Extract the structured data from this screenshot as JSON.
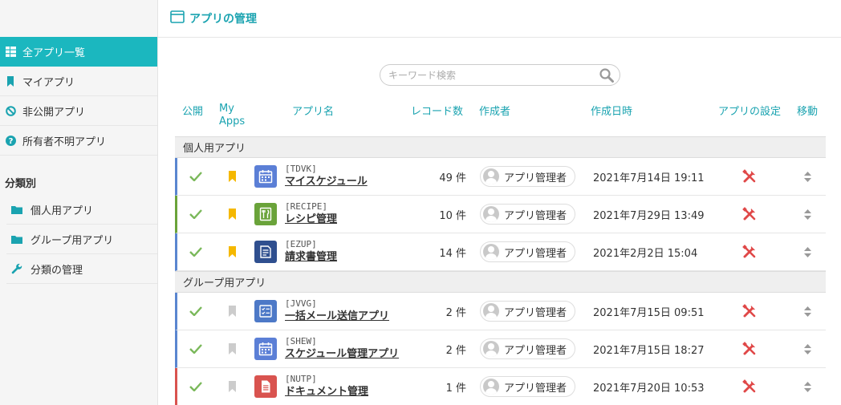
{
  "header": {
    "title": "アプリの管理",
    "icon": "window-icon"
  },
  "sidebar": {
    "items": [
      {
        "label": "全アプリ一覧",
        "icon": "grid-icon",
        "active": true
      },
      {
        "label": "マイアプリ",
        "icon": "bookmark-icon"
      },
      {
        "label": "非公開アプリ",
        "icon": "forbidden-icon"
      },
      {
        "label": "所有者不明アプリ",
        "icon": "question-icon"
      }
    ],
    "category_heading": "分類別",
    "categories": [
      {
        "label": "個人用アプリ",
        "icon": "folder-icon"
      },
      {
        "label": "グループ用アプリ",
        "icon": "folder-icon"
      },
      {
        "label": "分類の管理",
        "icon": "wrench-icon"
      }
    ]
  },
  "search": {
    "placeholder": "キーワード検索",
    "value": ""
  },
  "columns": {
    "public": "公開",
    "myapps_1": "My",
    "myapps_2": "Apps",
    "app_name": "アプリ名",
    "records": "レコード数",
    "creator": "作成者",
    "created": "作成日時",
    "settings": "アプリの設定",
    "move": "移動"
  },
  "groups": [
    {
      "label": "個人用アプリ",
      "apps": [
        {
          "code": "[TDVK]",
          "name": "マイスケジュール",
          "records": "49 件",
          "creator": "アプリ管理者",
          "created": "2021年7月14日 19:11",
          "starred": true,
          "icon": "calendar-icon",
          "icon_color": "#5b7fd6",
          "accent": "#5a86d0"
        },
        {
          "code": "[RECIPE]",
          "name": "レシピ管理",
          "records": "10 件",
          "creator": "アプリ管理者",
          "created": "2021年7月29日 13:49",
          "starred": true,
          "icon": "fork-knife-icon",
          "icon_color": "#6aa33a",
          "accent": "#6aa33a"
        },
        {
          "code": "[EZUP]",
          "name": "請求書管理",
          "records": "14 件",
          "creator": "アプリ管理者",
          "created": "2021年2月2日 15:04",
          "starred": true,
          "icon": "invoice-icon",
          "icon_color": "#2f4f8f",
          "accent": "#5a86d0"
        }
      ]
    },
    {
      "label": "グループ用アプリ",
      "apps": [
        {
          "code": "[JVVG]",
          "name": "一括メール送信アプリ",
          "records": "2 件",
          "creator": "アプリ管理者",
          "created": "2021年7月15日 09:51",
          "starred": false,
          "icon": "checklist-icon",
          "icon_color": "#4d79c7",
          "accent": "#5a86d0"
        },
        {
          "code": "[SHEW]",
          "name": "スケジュール管理アプリ",
          "records": "2 件",
          "creator": "アプリ管理者",
          "created": "2021年7月15日 18:27",
          "starred": false,
          "icon": "calendar-icon",
          "icon_color": "#5b7fd6",
          "accent": "#5a86d0"
        },
        {
          "code": "[NUTP]",
          "name": "ドキュメント管理",
          "records": "1 件",
          "creator": "アプリ管理者",
          "created": "2021年7月20日 10:53",
          "starred": false,
          "icon": "document-icon",
          "icon_color": "#d9534f",
          "accent": "#d9534f"
        }
      ]
    }
  ],
  "colors": {
    "accent": "#1bb7bf",
    "link": "#1aa3b0",
    "check": "#7ab85a",
    "star_on": "#f5b800",
    "star_off": "#cccccc",
    "settings": "#e04848"
  }
}
